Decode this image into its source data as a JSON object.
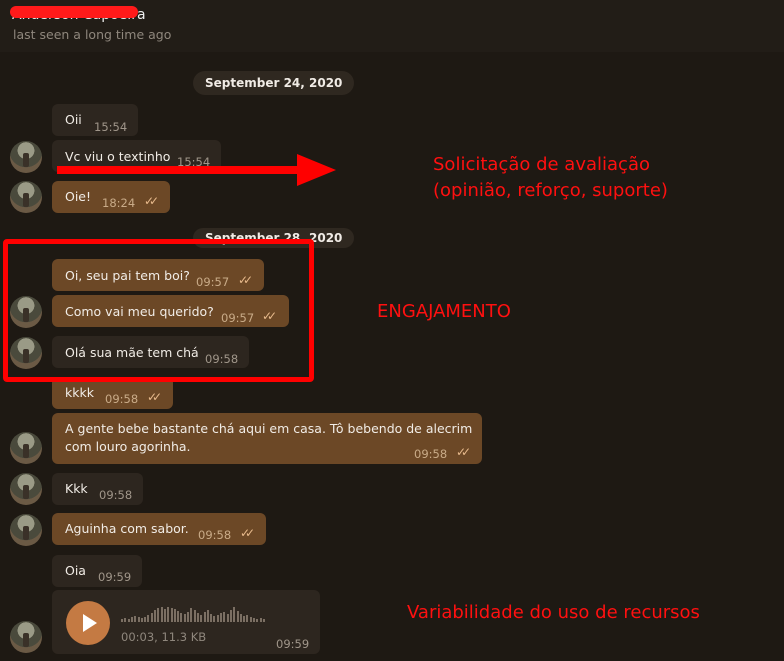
{
  "header": {
    "contact_name": "Anderson Capoeira",
    "last_seen": "last seen a long time ago"
  },
  "dates": [
    "September 24, 2020",
    "September 28, 2020"
  ],
  "messages": [
    {
      "text": "Oii",
      "time": "15:54",
      "dir": "in"
    },
    {
      "text": "Vc viu o textinho",
      "time": "15:54",
      "dir": "in"
    },
    {
      "text": "Oie!",
      "time": "18:24",
      "dir": "out"
    },
    {
      "text": "Oi, seu pai tem boi?",
      "time": "09:57",
      "dir": "out"
    },
    {
      "text": "Como vai meu querido?",
      "time": "09:57",
      "dir": "out"
    },
    {
      "text": "Olá sua mãe tem chá",
      "time": "09:58",
      "dir": "in"
    },
    {
      "text": "kkkk",
      "time": "09:58",
      "dir": "out"
    },
    {
      "text": "A gente bebe bastante chá aqui em casa. Tô bebendo de alecrim",
      "text2": "com louro agorinha.",
      "time": "09:58",
      "dir": "out"
    },
    {
      "text": "Kkk",
      "time": "09:58",
      "dir": "in"
    },
    {
      "text": "Aguinha com sabor.",
      "time": "09:58",
      "dir": "out"
    },
    {
      "text": "Oia",
      "time": "09:59",
      "dir": "in"
    }
  ],
  "voice": {
    "meta": "00:03, 11.3 KB",
    "time": "09:59",
    "waveform": [
      3,
      4,
      3,
      5,
      6,
      5,
      4,
      5,
      7,
      9,
      12,
      14,
      15,
      13,
      15,
      14,
      13,
      11,
      9,
      8,
      10,
      14,
      12,
      9,
      7,
      10,
      12,
      8,
      6,
      7,
      9,
      10,
      8,
      12,
      15,
      11,
      8,
      6,
      7,
      5,
      4,
      3,
      4,
      3
    ]
  },
  "annotations": {
    "evaluation_line1": "Solicitação de avaliação",
    "evaluation_line2": "(opinião, reforço, suporte)",
    "engagement": "ENGAJAMENTO",
    "resources": "Variabilidade do uso de recursos"
  },
  "colors": {
    "annotation_red": "#ff1010",
    "outgoing_bubble": "#6c4826",
    "incoming_bubble": "#2d261f",
    "play_button": "#c47a43"
  }
}
